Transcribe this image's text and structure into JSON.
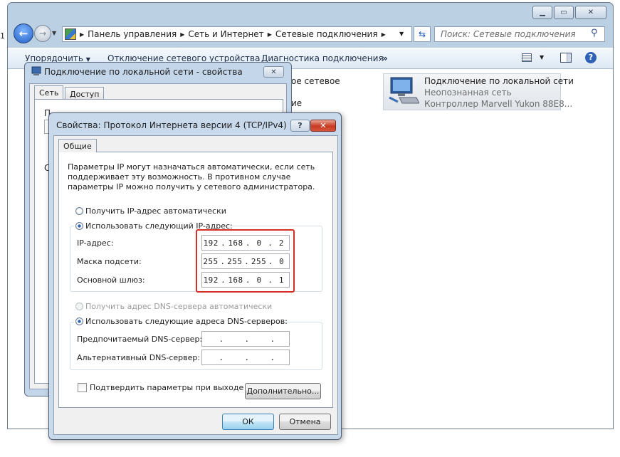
{
  "explorer": {
    "breadcrumb": [
      "Панель управления",
      "Сеть и Интернет",
      "Сетевые подключения"
    ],
    "search_placeholder": "Поиск: Сетевые подключения",
    "cmdbar": {
      "organize": "Упорядочить",
      "disable": "Отключение сетевого устройства",
      "diagnose": "Диагностика подключения",
      "more": "»"
    },
    "partial_text_1": "ое сетевое",
    "partial_text_2": "ие",
    "left_edge_text": "1",
    "connection": {
      "name": "Подключение по локальной сети",
      "status": "Неопознанная сеть",
      "adapter": "Контроллер Marvell Yukon 88E8..."
    }
  },
  "props_dialog": {
    "title": "Подключение по локальной сети - свойства",
    "tabs": [
      "Сеть",
      "Доступ"
    ],
    "edge_letters": [
      "П",
      "С"
    ]
  },
  "ipv4_dialog": {
    "title": "Свойства: Протокол Интернета версии 4 (TCP/IPv4)",
    "tab": "Общие",
    "info": "Параметры IP могут назначаться автоматически, если сеть поддерживает эту возможность. В противном случае параметры IP можно получить у сетевого администратора.",
    "radio_ip_auto": "Получить IP-адрес автоматически",
    "radio_ip_manual": "Использовать следующий IP-адрес:",
    "ip_label": "IP-адрес:",
    "mask_label": "Маска подсети:",
    "gateway_label": "Основной шлюз:",
    "ip": [
      "192",
      "168",
      "0",
      "2"
    ],
    "mask": [
      "255",
      "255",
      "255",
      "0"
    ],
    "gateway": [
      "192",
      "168",
      "0",
      "1"
    ],
    "radio_dns_auto": "Получить адрес DNS-сервера автоматически",
    "radio_dns_manual": "Использовать следующие адреса DNS-серверов:",
    "dns1_label": "Предпочитаемый DNS-сервер:",
    "dns2_label": "Альтернативный DNS-сервер:",
    "dns1": [
      ".",
      ".",
      "."
    ],
    "dns2": [
      ".",
      ".",
      "."
    ],
    "confirm_label": "Подтвердить параметры при выходе",
    "advanced_button": "Дополнительно...",
    "ok_button": "ОК",
    "cancel_button": "Отмена",
    "highlight_color": "#d42f25"
  }
}
